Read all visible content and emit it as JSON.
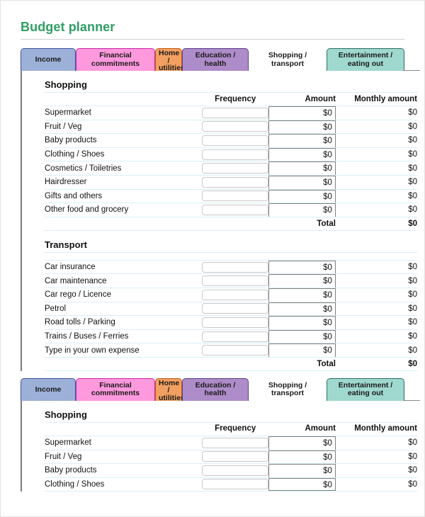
{
  "document": {
    "title": "Budget planner"
  },
  "tabs": [
    {
      "label": "Income",
      "name": "tab-income",
      "active": false,
      "color": "#9db0d8",
      "border": "#3c52a0"
    },
    {
      "label": "Financial commitments",
      "name": "tab-financial",
      "active": false,
      "color": "#ff99dd",
      "border": "#cc27a7"
    },
    {
      "label": "Home / utilities",
      "name": "tab-home",
      "active": false,
      "color": "#f2a061",
      "border": "#c05a13"
    },
    {
      "label": "Education / health",
      "name": "tab-education",
      "active": false,
      "color": "#ad8cc9",
      "border": "#5b3f8c"
    },
    {
      "label": "Shopping / transport",
      "name": "tab-shopping",
      "active": true,
      "color": "#ffffff",
      "border": "#ffffff"
    },
    {
      "label": "Entertainment / eating out",
      "name": "tab-entertainment",
      "active": false,
      "color": "#9ed8ce",
      "border": "#2f6f63"
    }
  ],
  "columns": {
    "label": "",
    "frequency": "Frequency",
    "amount": "Amount",
    "monthly": "Monthly amount"
  },
  "total_label": "Total",
  "panel1": {
    "sections": [
      {
        "title": "Shopping",
        "rows": [
          {
            "label": "Supermarket",
            "frequency": "",
            "amount": "$0",
            "monthly": "$0"
          },
          {
            "label": "Fruit / Veg",
            "frequency": "",
            "amount": "$0",
            "monthly": "$0"
          },
          {
            "label": "Baby products",
            "frequency": "",
            "amount": "$0",
            "monthly": "$0"
          },
          {
            "label": "Clothing / Shoes",
            "frequency": "",
            "amount": "$0",
            "monthly": "$0"
          },
          {
            "label": "Cosmetics / Toiletries",
            "frequency": "",
            "amount": "$0",
            "monthly": "$0"
          },
          {
            "label": "Hairdresser",
            "frequency": "",
            "amount": "$0",
            "monthly": "$0"
          },
          {
            "label": "Gifts and others",
            "frequency": "",
            "amount": "$0",
            "monthly": "$0"
          },
          {
            "label": "Other food and grocery",
            "frequency": "",
            "amount": "$0",
            "monthly": "$0"
          }
        ],
        "total": "$0"
      },
      {
        "title": "Transport",
        "rows": [
          {
            "label": "Car insurance",
            "frequency": "",
            "amount": "$0",
            "monthly": "$0"
          },
          {
            "label": "Car maintenance",
            "frequency": "",
            "amount": "$0",
            "monthly": "$0"
          },
          {
            "label": "Car rego / Licence",
            "frequency": "",
            "amount": "$0",
            "monthly": "$0"
          },
          {
            "label": "Petrol",
            "frequency": "",
            "amount": "$0",
            "monthly": "$0"
          },
          {
            "label": "Road tolls / Parking",
            "frequency": "",
            "amount": "$0",
            "monthly": "$0"
          },
          {
            "label": "Trains / Buses / Ferries",
            "frequency": "",
            "amount": "$0",
            "monthly": "$0"
          },
          {
            "label": "Type in your own expense",
            "frequency": "",
            "amount": "$0",
            "monthly": "$0"
          }
        ],
        "total": "$0"
      }
    ]
  },
  "panel2": {
    "sections": [
      {
        "title": "Shopping",
        "rows": [
          {
            "label": "Supermarket",
            "frequency": "",
            "amount": "$0",
            "monthly": "$0"
          },
          {
            "label": "Fruit / Veg",
            "frequency": "",
            "amount": "$0",
            "monthly": "$0"
          },
          {
            "label": "Baby products",
            "frequency": "",
            "amount": "$0",
            "monthly": "$0"
          },
          {
            "label": "Clothing / Shoes",
            "frequency": "",
            "amount": "$0",
            "monthly": "$0"
          }
        ],
        "total": null
      }
    ]
  }
}
